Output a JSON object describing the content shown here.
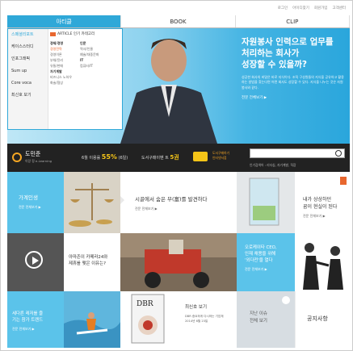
{
  "util": [
    "로그인",
    "아이디찾기",
    "회원가입",
    "고객센터"
  ],
  "tabs": [
    {
      "label": "아티클",
      "active": true
    },
    {
      "label": "BOOK",
      "active": false
    },
    {
      "label": "CLIP",
      "active": false
    }
  ],
  "dropdown": {
    "left_items": [
      "스페셜리포트",
      "케이스스터디",
      "인포그래픽",
      "Sum up",
      "Core voca",
      "최신호 보기"
    ],
    "header": "ARTICLE 인기 카테고리",
    "col1": {
      "h1": "경제/경영",
      "items1": [
        "경영전략",
        "경영이론",
        "부채/윤리",
        "유통/판매"
      ],
      "h2": "자기계발",
      "items2": [
        "비즈니스 노하우",
        "화술/협상"
      ]
    },
    "col2": {
      "h1": "인문",
      "items1": [
        "역사/인물",
        "예술/대중문화"
      ],
      "h2": "IT",
      "items2": [
        "컴퓨터/IT"
      ]
    }
  },
  "hero": {
    "title": "자원봉사 인력으로 업무를\n처리하는 회사가\n성장할 수 있을까?",
    "body": "성공한 회사의 비밀은 바로 지식이다. 조직 구성원들의 지식을 공유하고 활용하는 방법을 찾는다면 어떤 회사도 성장할 수 있다. 지식을 나누는 것은 자원봉사와 같다.",
    "link": "전문 전체보기 ▶"
  },
  "bar": {
    "name": "도민준",
    "sub": "이랑 정 e-Learning",
    "stat1_label": "6월 이용률",
    "stat1_value": "55%",
    "stat1_suffix": "(6일)",
    "stat2_label": "도서구매이벤 트",
    "stat2_value": "5권",
    "cta": "도서구매하기\n인터넷서점",
    "pop": "인기검색어 : 리더십, 자기계발, 직장"
  },
  "tiles": {
    "t1": {
      "text": "가계인생",
      "more": "전문 전체보기 ▶"
    },
    "t2": {
      "text": "시골에서 숨은 부(富)를 발견하다",
      "more": "전문 전체보기 ▶"
    },
    "t3": {
      "text": "내가 상상하던\n꿈이 현실이 된다",
      "more": "전문 전체보기 ▶"
    },
    "t4": {
      "text": "아마존이 카메라24와\n제휴를 맺은 이유는?",
      "more": ""
    },
    "t5": {
      "text": "오로케이타 CEO,\n인재 채용을 위해\n'외다전'을 열다",
      "more": "전문 전체보기 ▶"
    },
    "t6": {
      "text": "세다른 레저를 즐\n기는 참가 트렌드",
      "more": "전문 전체보기 ▶"
    },
    "t7": {
      "title": "최신호 보기",
      "line1": "DBR 중요하게 다시하는 기업체",
      "line2": "2014년 6월 23일"
    },
    "t8": {
      "text": "지난 이슈\n전체 보기",
      "more": ""
    },
    "t9": {
      "text": "공지사항"
    }
  },
  "colors": {
    "brand": "#2fa8d8",
    "accent": "#f5c518"
  }
}
